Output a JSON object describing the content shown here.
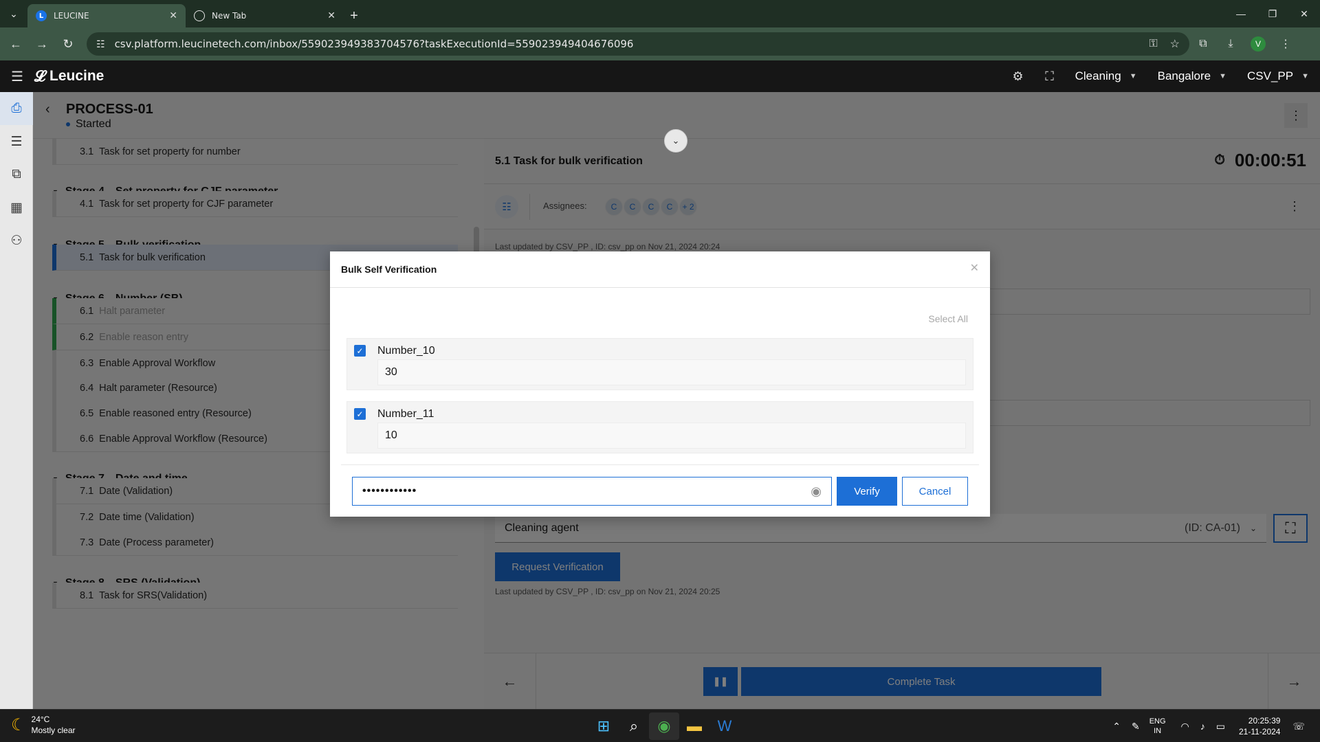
{
  "browser": {
    "tabs": [
      {
        "title": "LEUCINE",
        "active": true
      },
      {
        "title": "New Tab",
        "active": false
      }
    ],
    "url": "csv.platform.leucinetech.com/inbox/559023949383704576?taskExecutionId=559023949404676096",
    "profile_initial": "V"
  },
  "app_header": {
    "brand": "Leucine",
    "selectors": [
      {
        "label": "Cleaning"
      },
      {
        "label": "Bangalore"
      },
      {
        "label": "CSV_PP"
      }
    ]
  },
  "process": {
    "title": "PROCESS-01",
    "status": "Started"
  },
  "task_list": {
    "items": [
      {
        "type": "task",
        "num": "3.1",
        "name": "Task for set property for number",
        "state": "default"
      },
      {
        "type": "stage",
        "num": "Stage 4",
        "name": "Set property for CJF parameter"
      },
      {
        "type": "task",
        "num": "4.1",
        "name": "Task for set property for CJF parameter",
        "state": "default"
      },
      {
        "type": "stage",
        "num": "Stage 5",
        "name": "Bulk verification"
      },
      {
        "type": "task",
        "num": "5.1",
        "name": "Task for bulk verification",
        "state": "active"
      },
      {
        "type": "stage",
        "num": "Stage 6",
        "name": "Number (SB)"
      },
      {
        "type": "task",
        "num": "6.1",
        "name": "Halt parameter",
        "state": "done"
      },
      {
        "type": "task",
        "num": "6.2",
        "name": "Enable reason entry",
        "state": "done"
      },
      {
        "type": "task",
        "num": "6.3",
        "name": "Enable Approval Workflow",
        "state": "default"
      },
      {
        "type": "task",
        "num": "6.4",
        "name": "Halt parameter (Resource)",
        "state": "default"
      },
      {
        "type": "task",
        "num": "6.5",
        "name": "Enable reasoned entry (Resource)",
        "state": "default"
      },
      {
        "type": "task",
        "num": "6.6",
        "name": "Enable Approval Workflow (Resource)",
        "state": "default"
      },
      {
        "type": "stage",
        "num": "Stage 7",
        "name": "Date and time"
      },
      {
        "type": "task",
        "num": "7.1",
        "name": "Date (Validation)",
        "state": "default"
      },
      {
        "type": "task",
        "num": "7.2",
        "name": "Date time (Validation)",
        "state": "default"
      },
      {
        "type": "task",
        "num": "7.3",
        "name": "Date (Process parameter)",
        "state": "default"
      },
      {
        "type": "stage",
        "num": "Stage 8",
        "name": "SRS (Validation)"
      },
      {
        "type": "task",
        "num": "8.1",
        "name": "Task for SRS(Validation)",
        "state": "default"
      }
    ]
  },
  "task_detail": {
    "title": "5.1 Task for bulk verification",
    "timer": "00:00:51",
    "assignees_label": "Assignees:",
    "assignee_avatars": [
      "C",
      "C",
      "C",
      "C",
      "+ 2"
    ],
    "updated_top": "Last updated by CSV_PP , ID: csv_pp on Nov 21, 2024 20:24",
    "resource": {
      "name": "Cleaning agent",
      "id": "(ID: CA-01)"
    },
    "request_verification_label": "Request Verification",
    "updated_bottom": "Last updated by CSV_PP , ID: csv_pp on Nov 21, 2024 20:25",
    "complete_task_label": "Complete Task"
  },
  "modal": {
    "title": "Bulk Self Verification",
    "select_all_label": "Select All",
    "params": [
      {
        "name": "Number_10",
        "value": "30",
        "checked": true
      },
      {
        "name": "Number_11",
        "value": "10",
        "checked": true
      }
    ],
    "password_value": "••••••••••••",
    "verify_label": "Verify",
    "cancel_label": "Cancel"
  },
  "taskbar": {
    "temperature": "24°C",
    "weather": "Mostly clear",
    "lang_top": "ENG",
    "lang_bottom": "IN",
    "time": "20:25:39",
    "date": "21-11-2024"
  }
}
